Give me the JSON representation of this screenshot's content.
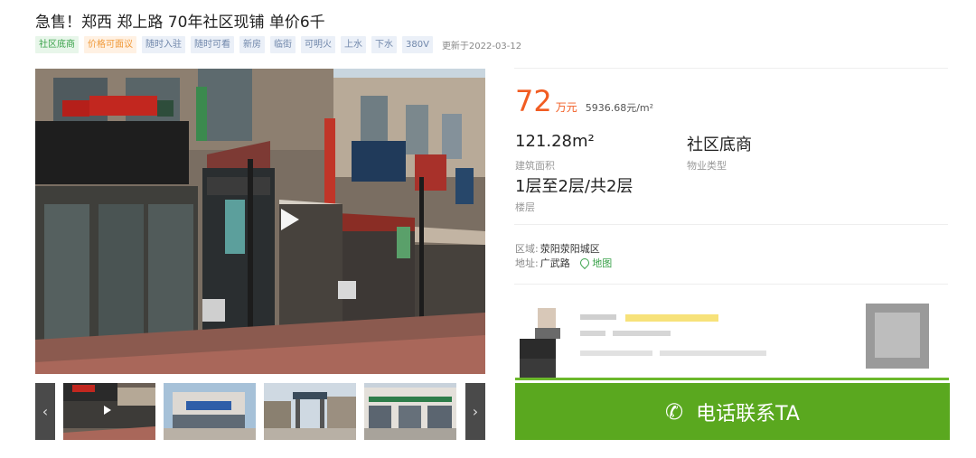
{
  "listing": {
    "title": "急售！郑西 郑上路 70年社区现铺 单价6千",
    "update_text": "更新于2022-03-12"
  },
  "tags": [
    {
      "label": "社区底商",
      "style": "green"
    },
    {
      "label": "价格可面议",
      "style": "orange"
    },
    {
      "label": "随时入驻",
      "style": "blue"
    },
    {
      "label": "随时可看",
      "style": "blue"
    },
    {
      "label": "新房",
      "style": "blue"
    },
    {
      "label": "临街",
      "style": "blue"
    },
    {
      "label": "可明火",
      "style": "blue"
    },
    {
      "label": "上水",
      "style": "blue"
    },
    {
      "label": "下水",
      "style": "blue"
    },
    {
      "label": "380V",
      "style": "blue"
    }
  ],
  "price": {
    "total": "72",
    "unit": "万元",
    "per_sqm": "5936.68元/m²",
    "color": "#f15c22"
  },
  "info": {
    "area_value": "121.28m²",
    "area_label": "建筑面积",
    "type_value": "社区底商",
    "type_label": "物业类型",
    "floor_value": "1层至2层/共2层",
    "floor_label": "楼层"
  },
  "location": {
    "region_label": "区域:",
    "region_value": "荥阳荥阳城区",
    "address_label": "地址:",
    "address_value": "广武路",
    "map_link": "地图"
  },
  "gallery": {
    "prev_icon": "‹",
    "next_icon": "›",
    "thumbnail_count": 4,
    "play_icon": "play-icon"
  },
  "contact": {
    "call_label": "电话联系TA",
    "phone_icon": "✆",
    "accent": "#5aa81f"
  }
}
